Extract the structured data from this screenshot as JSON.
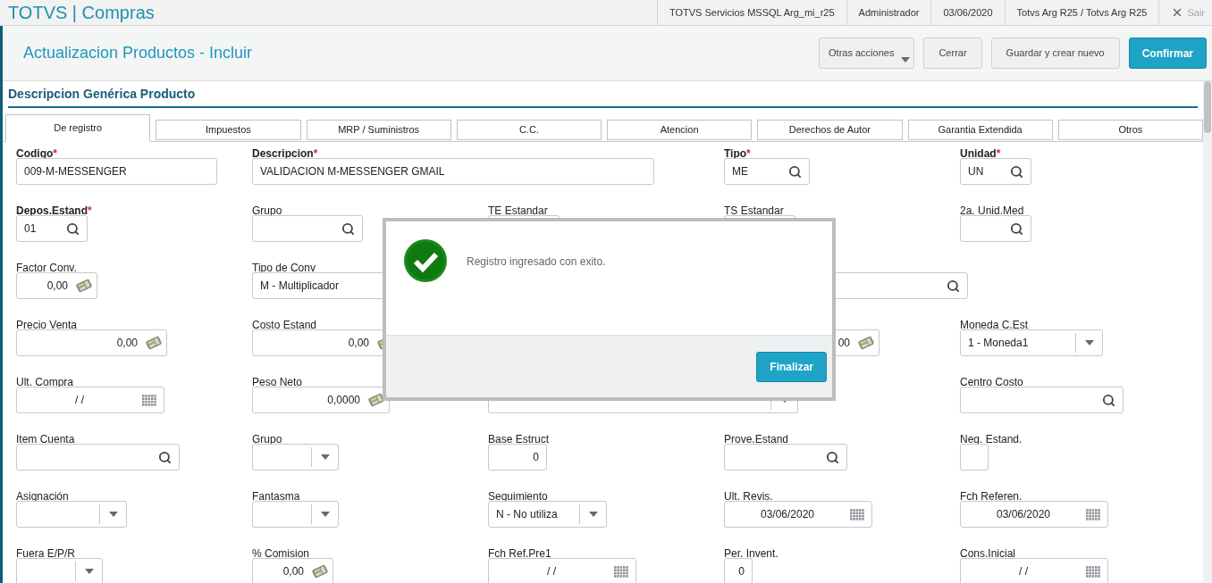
{
  "app_title": "TOTVS | Compras",
  "top_bar": [
    "TOTVS Servicios MSSQL Arg_mi_r25",
    "Administrador",
    "03/06/2020",
    "Totvs Arg R25 / Totvs Arg R25"
  ],
  "exit": {
    "label": "Sair",
    "disabled": true
  },
  "page_title": "Actualizacion Productos - Incluir",
  "actions": [
    {
      "label": "Otras acciones",
      "kind": "menu"
    },
    {
      "label": "Cerrar",
      "kind": "plain"
    },
    {
      "label": "Guardar y crear nuevo",
      "kind": "plain"
    },
    {
      "label": "Confirmar",
      "kind": "primary"
    }
  ],
  "section_title": "Descripcion Genérica Producto",
  "tabs": [
    {
      "label": "De registro",
      "selected": true
    },
    {
      "label": "Impuestos",
      "selected": false
    },
    {
      "label": "MRP / Suministros",
      "selected": false
    },
    {
      "label": "C.C.",
      "selected": false
    },
    {
      "label": "Atencion",
      "selected": false
    },
    {
      "label": "Derechos de Autor",
      "selected": false
    },
    {
      "label": "Garantia Extendida",
      "selected": false
    },
    {
      "label": "Otros",
      "selected": false
    }
  ],
  "rows": [
    [
      {
        "label": "Codigo",
        "required": true,
        "asterisk": "*",
        "kind": "text",
        "value": "009-M-MESSENGER"
      },
      {
        "label": "Descripcion",
        "required": true,
        "asterisk": "*",
        "kind": "text",
        "value": "VALIDACION M-MESSENGER GMAIL"
      },
      null,
      {
        "label": "Tipo",
        "required": true,
        "asterisk": "*",
        "kind": "search",
        "value": "ME"
      },
      {
        "label": "Unidad",
        "required": true,
        "asterisk": "*",
        "kind": "search",
        "value": "UN"
      }
    ],
    [
      {
        "label": "Depos.Estand",
        "required": true,
        "asterisk": "*",
        "kind": "search",
        "value": "01"
      },
      {
        "label": "Grupo",
        "required": false,
        "kind": "search"
      },
      {
        "label": "TE Estandar",
        "required": false,
        "kind": "plain"
      },
      {
        "label": "TS Estandar",
        "required": false,
        "kind": "plain"
      },
      {
        "label": "2a. Unid.Med",
        "required": false,
        "kind": "search"
      }
    ],
    [
      {
        "label": "Factor Conv.",
        "required": false,
        "kind": "calc",
        "value": "0,00"
      },
      {
        "label": "Tipo de Conv",
        "required": false,
        "kind": "text",
        "value": "M - Multiplicador"
      },
      null,
      {
        "kind": "search"
      },
      null
    ],
    [
      {
        "label": "Precio Venta",
        "required": false,
        "kind": "calc",
        "value": "0,00"
      },
      {
        "label": "Costo Estand",
        "required": false,
        "kind": "calc",
        "value": "0,00"
      },
      null,
      {
        "kind": "calc",
        "value": "00"
      },
      {
        "label": "Moneda C.Est",
        "required": false,
        "kind": "select",
        "value": "1 - Moneda1"
      }
    ],
    [
      {
        "label": "Ult. Compra",
        "required": false,
        "kind": "date",
        "value": "/  /"
      },
      {
        "label": "Peso Neto",
        "required": false,
        "kind": "calc",
        "value": "0,0000"
      },
      {
        "kind": "select"
      },
      null,
      {
        "label": "Centro Costo",
        "required": false,
        "kind": "search"
      }
    ],
    [
      {
        "label": "Item Cuenta",
        "required": false,
        "kind": "search"
      },
      {
        "label": "Grupo",
        "required": false,
        "kind": "select"
      },
      {
        "label": "Base Estruct",
        "required": false,
        "kind": "plain",
        "value": "0"
      },
      {
        "label": "Prove.Estand",
        "required": false,
        "kind": "search"
      },
      {
        "label": "Neg. Estand.",
        "required": false,
        "kind": "plain"
      }
    ],
    [
      {
        "label": "Asignación",
        "required": false,
        "kind": "select"
      },
      {
        "label": "Fantasma",
        "required": false,
        "kind": "select"
      },
      {
        "label": "Seguimiento",
        "required": false,
        "kind": "select",
        "value": "N - No utiliza"
      },
      {
        "label": "Ult. Revis.",
        "required": false,
        "kind": "date",
        "value": "03/06/2020"
      },
      {
        "label": "Fch Referen.",
        "required": false,
        "kind": "date",
        "value": "03/06/2020"
      }
    ],
    [
      {
        "label": "Fuera E/P/R",
        "required": false,
        "kind": "select"
      },
      {
        "label": "% Comision",
        "required": false,
        "kind": "calc",
        "value": "0,00"
      },
      {
        "label": "Fch Ref.Pre1",
        "required": false,
        "kind": "date",
        "value": "/  /"
      },
      {
        "label": "Per. Invent.",
        "required": false,
        "kind": "plain",
        "value": "0"
      },
      {
        "label": "Cons.Inicial",
        "required": false,
        "kind": "date",
        "value": "/  /"
      }
    ]
  ],
  "dialog": {
    "message": "Registro ingresado con exito.",
    "button": "Finalizar"
  }
}
